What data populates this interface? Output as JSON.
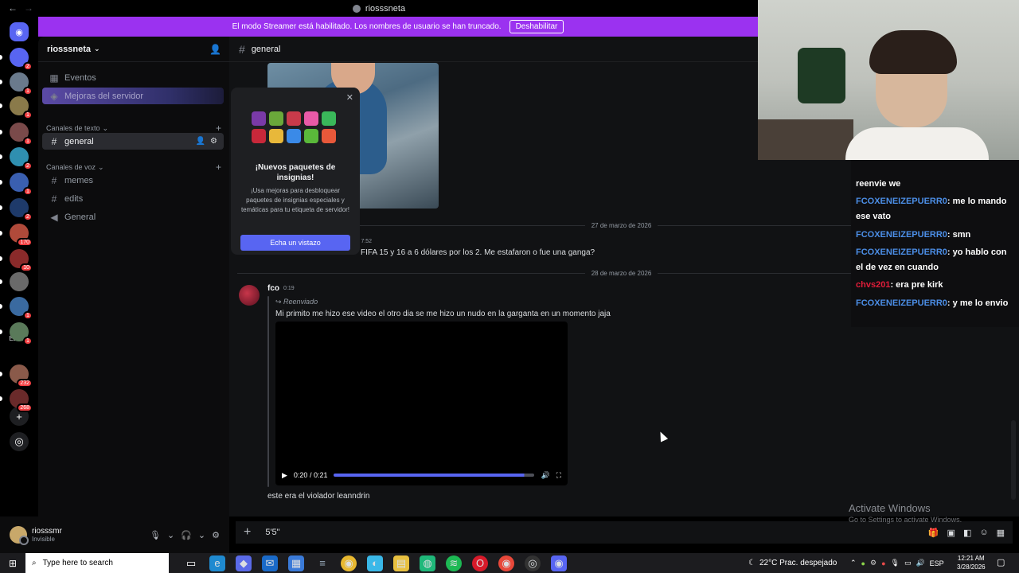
{
  "window": {
    "title": "riosssneta"
  },
  "banner": {
    "text": "El modo Streamer está habilitado. Los nombres de usuario se han truncado.",
    "button": "Deshabilitar"
  },
  "rail": {
    "servers": [
      {
        "badge": "2",
        "color": "#5865f2"
      },
      {
        "badge": "1",
        "color": "#6a7a8c"
      },
      {
        "badge": "1",
        "color": "#8a7a4a"
      },
      {
        "badge": "1",
        "color": "#7a4a4a"
      },
      {
        "badge": "2",
        "color": "#2f8fb0"
      },
      {
        "badge": "1",
        "color": "#3a5fb0"
      },
      {
        "badge": "2",
        "color": "#1e3a6a"
      },
      {
        "badge": "170",
        "color": "#b04a3a"
      },
      {
        "badge": "10",
        "color": "#8a2a2a"
      },
      {
        "badge": "",
        "color": "#6a6a6a"
      },
      {
        "badge": "1",
        "color": "#3a6aa0"
      },
      {
        "badge": "1",
        "color": "#5a7a5a"
      },
      {
        "badge": "232",
        "color": "#8a5a4a"
      },
      {
        "badge": "268",
        "color": "#6a2a2a"
      }
    ],
    "folder_label": "Esdm.r"
  },
  "server": {
    "name": "riosssneta",
    "items": {
      "events": "Eventos",
      "boosts": "Mejoras del servidor"
    },
    "text_category": "Canales de texto",
    "voice_category": "Canales de voz",
    "channels": {
      "general": "general",
      "memes": "memes",
      "edits": "edits",
      "voice_general": "General"
    }
  },
  "user": {
    "name": "riosssmr",
    "status": "Invisible"
  },
  "chat": {
    "channel": "general",
    "date1": "27 de marzo de 2026",
    "partial_time": "s 7:52",
    "msg_partial": "FIFA 15 y 16 a 6 dólares por los 2. Me estafaron o fue una ganga?",
    "date2": "28 de marzo de 2026",
    "author": "fco",
    "author_time": "0:19",
    "forwarded_label": "Reenviado",
    "forwarded_text": "Mi primito me hizo ese video el otro dia se me hizo un nudo en la garganta en un momento jaja",
    "video_time": "0:20 / 0:21",
    "video_progress": 0.95,
    "followup": "este era el violador leanndrin"
  },
  "composer": {
    "value": "5'5\""
  },
  "popup": {
    "title": "¡Nuevos paquetes de insignias!",
    "desc": "¡Usa mejoras para desbloquear paquetes de insignias especiales y temáticas para tu etiqueta de servidor!",
    "cta": "Echa un vistazo",
    "badge_colors": [
      "#7a3aa8",
      "#6aa83a",
      "#c83a4a",
      "#e85aa8",
      "#3ab85a",
      "#c8283a",
      "#e8b83a",
      "#3a8ae8",
      "#5ab83a",
      "#e8583a"
    ]
  },
  "overlay": {
    "lines": [
      {
        "user": "",
        "text": "reenvie we"
      },
      {
        "user": "FCOXENEIZEPUERR0",
        "text": ": me lo mando ese vato"
      },
      {
        "user": "FCOXENEIZEPUERR0",
        "text": ": smn"
      },
      {
        "user": "FCOXENEIZEPUERR0",
        "text": ": yo hablo con el de vez en cuando"
      },
      {
        "user": "chvs201",
        "text": ": era pre kirk"
      },
      {
        "user": "FCOXENEIZEPUERR0",
        "text": ": y me lo envio"
      }
    ]
  },
  "watermark": {
    "title": "Activate Windows",
    "sub": "Go to Settings to activate Windows."
  },
  "taskbar": {
    "search_placeholder": "Type here to search",
    "weather": "22°C  Prac. despejado",
    "lang": "ESP",
    "time": "12:21 AM",
    "date": "3/28/2026"
  }
}
